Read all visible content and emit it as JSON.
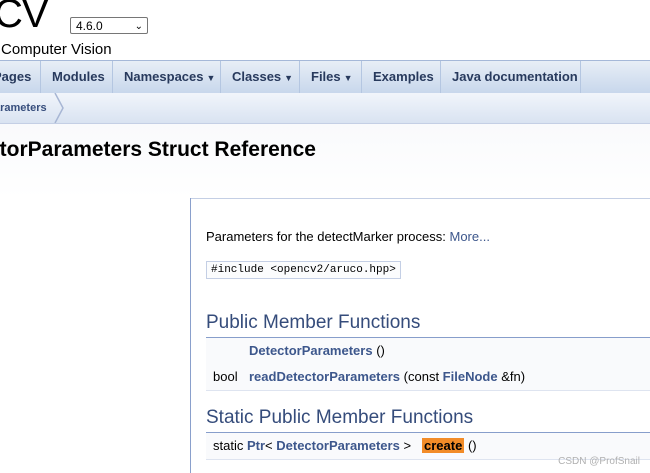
{
  "header": {
    "project_name": "CV",
    "project_brief": "Computer Vision",
    "version": "4.6.0"
  },
  "nav": {
    "tabs": [
      {
        "label": "Pages",
        "dropdown": false
      },
      {
        "label": "Modules",
        "dropdown": false
      },
      {
        "label": "Namespaces",
        "dropdown": true
      },
      {
        "label": "Classes",
        "dropdown": true
      },
      {
        "label": "Files",
        "dropdown": true
      },
      {
        "label": "Examples",
        "dropdown": false
      },
      {
        "label": "Java documentation",
        "dropdown": false
      }
    ]
  },
  "breadcrumb": {
    "current": "arameters"
  },
  "page": {
    "title": "ctorParameters Struct Reference"
  },
  "content": {
    "brief": "Parameters for the detectMarker process:",
    "more_link": "More...",
    "include": "#include <opencv2/aruco.hpp>",
    "sections": [
      {
        "title": "Public Member Functions",
        "rows": [
          {
            "type": "",
            "name": "DetectorParameters",
            "args": "()"
          },
          {
            "type": "bool",
            "name": "readDetectorParameters",
            "args_pre": "(const ",
            "args_link": "FileNode",
            "args_post": " &fn)"
          }
        ]
      },
      {
        "title": "Static Public Member Functions",
        "rows": [
          {
            "type": "static",
            "type_link": "Ptr",
            "type_mid": "<",
            "type_link2": "DetectorParameters",
            "type_post": ">",
            "name": "create",
            "args": "()"
          }
        ]
      }
    ]
  },
  "watermark": "CSDN @ProfSnail",
  "colors": {
    "link": "#3d578c",
    "highlight": "#f28c28",
    "section_header": "#354c7b"
  }
}
